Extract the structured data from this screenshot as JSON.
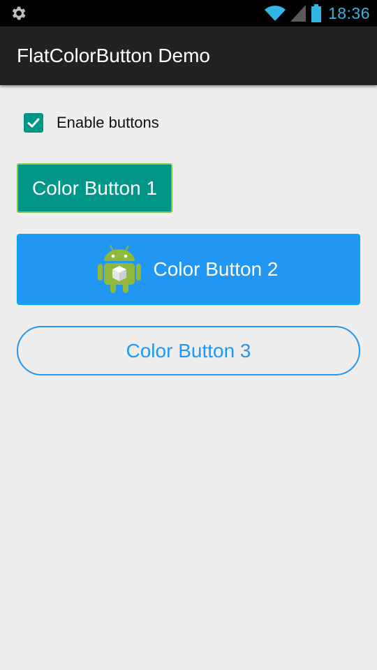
{
  "status_bar": {
    "time": "18:36",
    "time_color": "#33b5e5",
    "icons": [
      "settings-icon",
      "wifi-icon",
      "signal-icon",
      "battery-icon"
    ]
  },
  "action_bar": {
    "title": "FlatColorButton Demo",
    "background": "#222222"
  },
  "checkbox": {
    "label": "Enable buttons",
    "checked": true,
    "color": "#009688"
  },
  "buttons": [
    {
      "label": "Color Button 1",
      "background": "#009688",
      "border": "#8bc34a",
      "style": "filled"
    },
    {
      "label": "Color Button 2",
      "background": "#2196f3",
      "border": "#03a9f4",
      "style": "filled",
      "icon": "android-icon"
    },
    {
      "label": "Color Button 3",
      "background": "transparent",
      "border": "#2196f3",
      "style": "outline-rounded"
    }
  ],
  "page_background": "#eeeeee"
}
